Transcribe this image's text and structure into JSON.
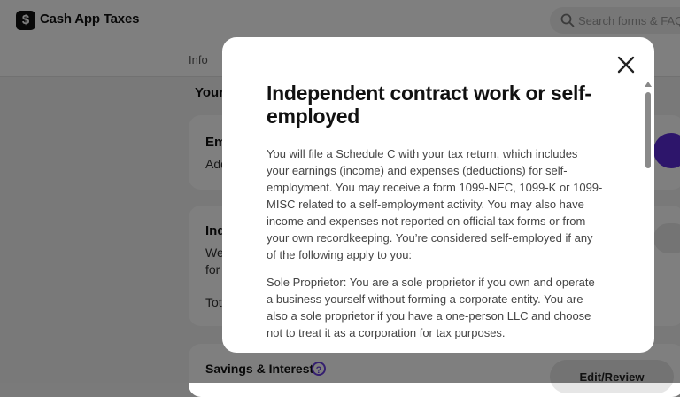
{
  "app": {
    "logo_glyph": "$",
    "name": "Cash App Taxes"
  },
  "search": {
    "placeholder": "Search forms & FAQs"
  },
  "subnav": {
    "tab_info": "Info"
  },
  "background": {
    "section_title_fragment": "Your",
    "card1": {
      "title_fragment": "Em",
      "sub_fragment": "Add"
    },
    "card2": {
      "title_fragment": "Ind",
      "line1_fragment": "We",
      "line2_fragment": "for",
      "total_fragment": "Tot"
    },
    "savings": {
      "title": "Savings & Interest",
      "help_glyph": "?",
      "edit_label": "Edit/Review"
    }
  },
  "modal": {
    "title": "Independent contract work or self-employed",
    "paragraph1": "You will file a Schedule C with your tax return, which includes your earnings (income) and expenses (deductions) for self-employment. You may receive a form 1099-NEC, 1099-K or 1099-MISC related to a self-employment activity. You may also have income and expenses not reported on official tax forms or from your own recordkeeping. You’re considered self-employed if any of the following apply to you:",
    "paragraph2": "Sole Proprietor: You are a sole proprietor if you own and operate a business yourself without forming a corporate entity. You are also a sole proprietor if you have a one-person LLC and choose not to treat it as a corporation for tax purposes.",
    "close_icon": "close-icon"
  },
  "colors": {
    "accent": "#5b2bd6",
    "overlay": "rgba(0,0,0,0.5)"
  }
}
